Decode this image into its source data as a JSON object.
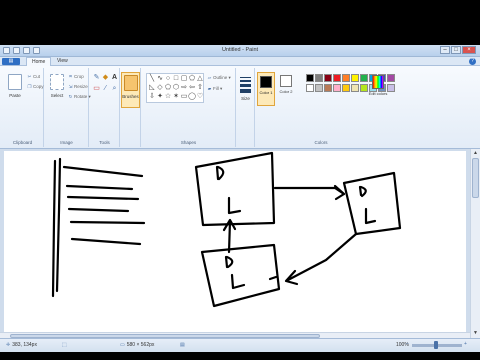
{
  "window": {
    "title": "Untitled - Paint"
  },
  "tabs": {
    "paint_menu": "▤",
    "home": "Home",
    "view": "View",
    "help_icon": "?"
  },
  "ribbon": {
    "clipboard": {
      "label": "Clipboard",
      "paste": "Paste",
      "cut": "Cut",
      "copy": "Copy"
    },
    "image": {
      "label": "Image",
      "select": "Select",
      "crop": "Crop",
      "resize": "Resize",
      "rotate": "Rotate ▾"
    },
    "tools": {
      "label": "Tools",
      "brushes": "Brushes"
    },
    "shapes": {
      "label": "Shapes",
      "outline": "Outline ▾",
      "fill": "Fill ▾"
    },
    "size": {
      "label": "Size"
    },
    "colors": {
      "label": "Colors",
      "color1": "Color 1",
      "color2": "Color 2",
      "edit": "Edit colors",
      "palette_row1": [
        "#000000",
        "#7f7f7f",
        "#880015",
        "#ed1c24",
        "#ff7f27",
        "#fff200",
        "#22b14c",
        "#00a2e8",
        "#3f48cc",
        "#a349a4"
      ],
      "palette_row2": [
        "#ffffff",
        "#c3c3c3",
        "#b97a57",
        "#ffaec9",
        "#ffc90e",
        "#efe4b0",
        "#b5e61d",
        "#99d9ea",
        "#7092be",
        "#c8bfe7"
      ],
      "color1_value": "#000000",
      "color2_value": "#ffffff"
    }
  },
  "status": {
    "cursor_pos": "383, 134px",
    "selection_size": "",
    "canvas_size": "580 × 562px",
    "zoom": "100%"
  }
}
